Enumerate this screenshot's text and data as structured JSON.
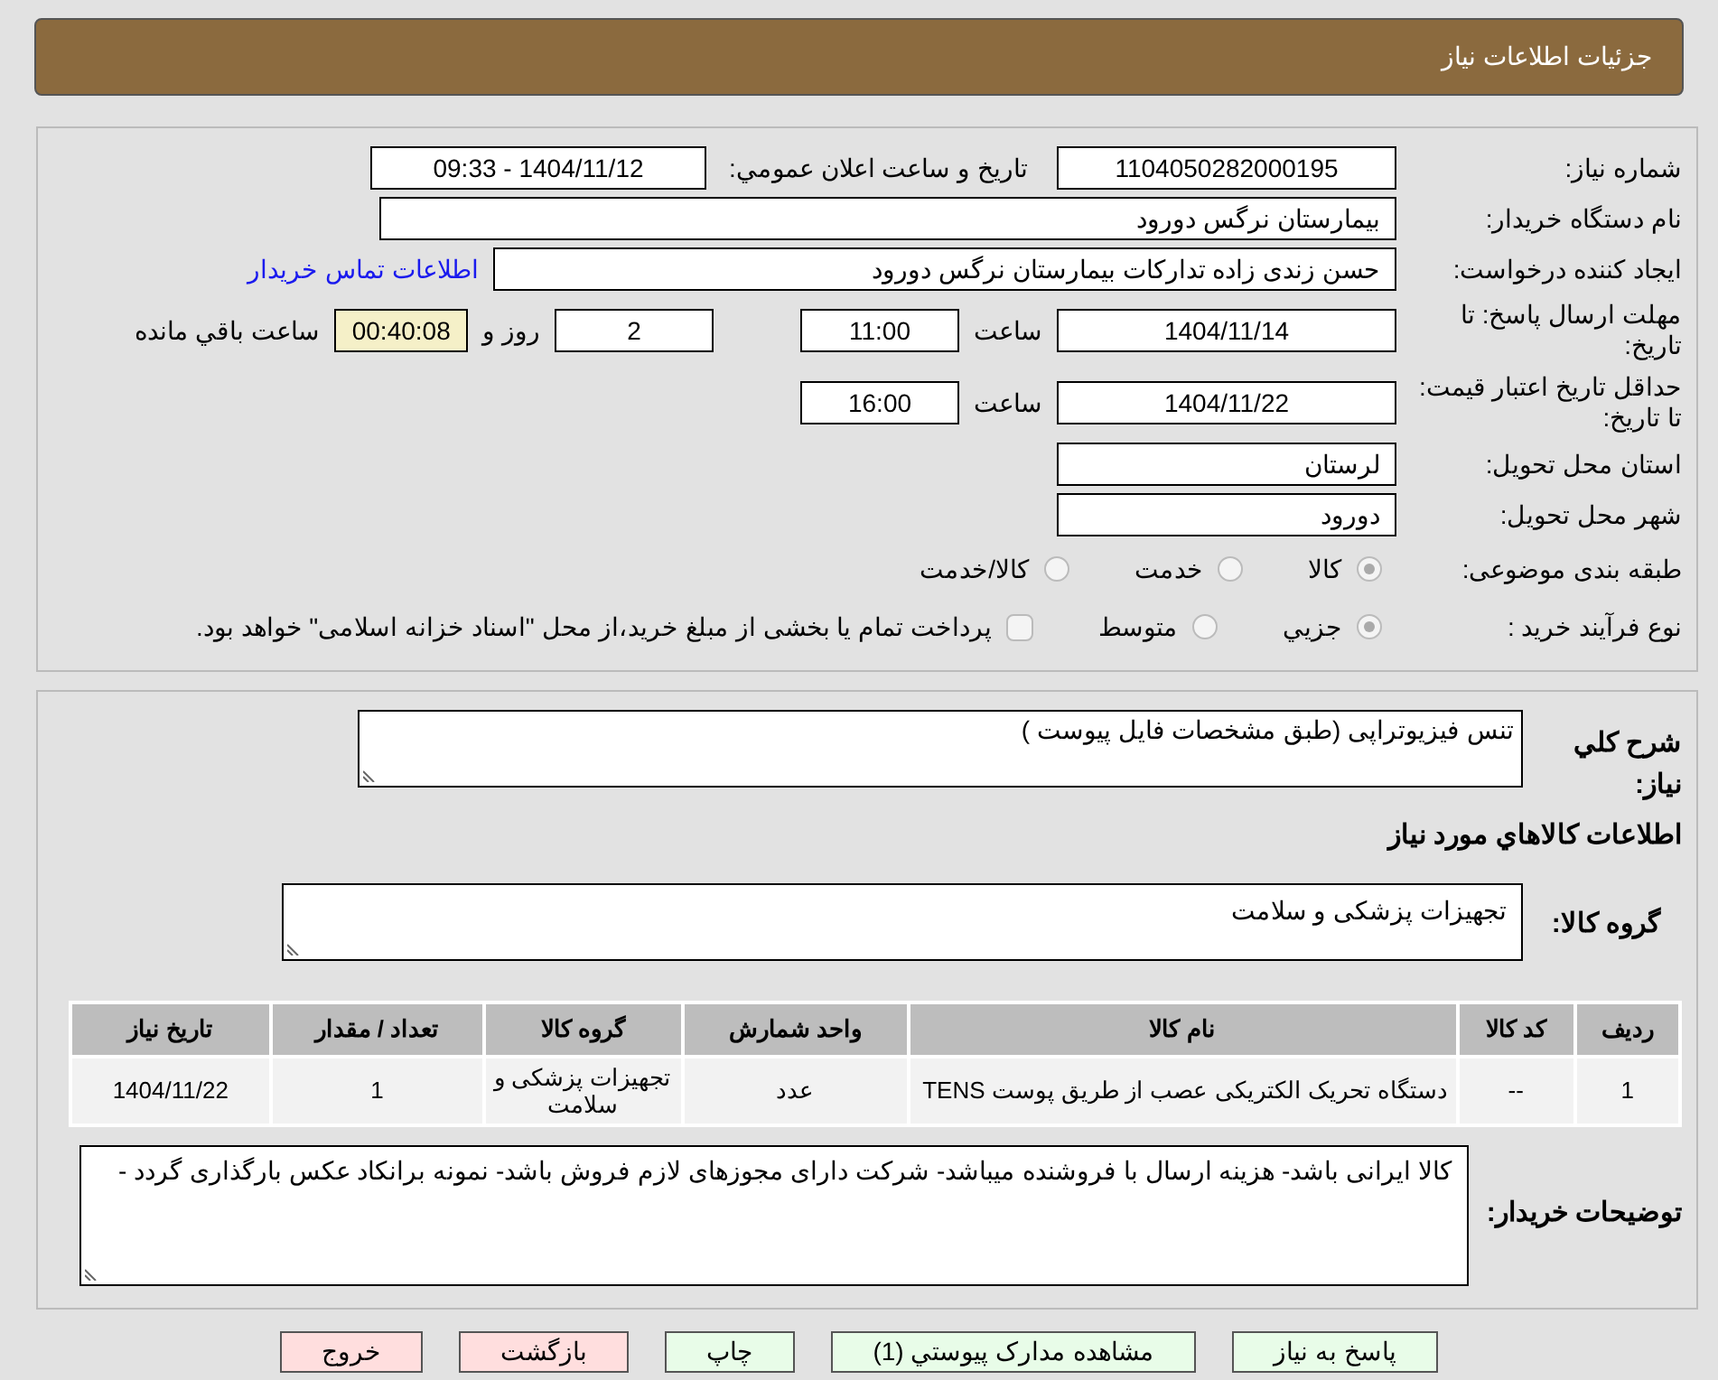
{
  "header": {
    "title": "جزئیات اطلاعات نیاز"
  },
  "need_number": {
    "label": "شماره نیاز:",
    "value": "1104050282000195"
  },
  "announce": {
    "label": "تاریخ و ساعت اعلان عمومي:",
    "value": "1404/11/12 - 09:33"
  },
  "buyer_org": {
    "label": "نام دستگاه خریدار:",
    "value": "بیمارستان نرگس دورود"
  },
  "requester": {
    "label": "ایجاد کننده درخواست:",
    "value": "حسن  زندی زاده  تدارکات بیمارستان نرگس دورود",
    "link": "اطلاعات تماس خریدار"
  },
  "deadline": {
    "label": "مهلت ارسال پاسخ: تا تاریخ:",
    "date": "1404/11/14",
    "time_label": "ساعت",
    "time": "11:00",
    "days": "2",
    "days_label": "روز و",
    "remaining": "00:40:08",
    "remaining_label": "ساعت باقي مانده"
  },
  "validity": {
    "label": "حداقل تاریخ اعتبار قیمت: تا تاریخ:",
    "date": "1404/11/22",
    "time_label": "ساعت",
    "time": "16:00"
  },
  "province": {
    "label": "استان محل تحویل:",
    "value": "لرستان"
  },
  "city": {
    "label": "شهر محل تحویل:",
    "value": "دورود"
  },
  "category": {
    "label": "طبقه بندی موضوعی:",
    "options": [
      {
        "label": "کالا",
        "selected": true
      },
      {
        "label": "خدمت",
        "selected": false
      },
      {
        "label": "کالا/خدمت",
        "selected": false
      }
    ]
  },
  "process": {
    "label": "نوع فرآیند خرید :",
    "options": [
      {
        "label": "جزيي",
        "selected": true
      },
      {
        "label": "متوسط",
        "selected": false
      }
    ],
    "checkbox": {
      "checked": false,
      "label": "پرداخت تمام یا بخشی از مبلغ خرید،از محل \"اسناد خزانه اسلامی\" خواهد بود."
    }
  },
  "description": {
    "label": "شرح کلي نیاز:",
    "value": "تنس فیزیوتراپی (طبق مشخصات فایل پیوست )"
  },
  "goods_title": "اطلاعات کالاهاي مورد نیاز",
  "goods_group": {
    "label": "گروه کالا:",
    "value": "تجهیزات پزشکی و سلامت"
  },
  "table": {
    "columns": [
      "ردیف",
      "کد کالا",
      "نام کالا",
      "واحد شمارش",
      "گروه کالا",
      "تعداد / مقدار",
      "تاریخ نیاز"
    ],
    "rows": [
      [
        "1",
        "--",
        "دستگاه تحریک الکتریکی عصب از طریق پوست TENS",
        "عدد",
        "تجهیزات پزشکی و سلامت",
        "1",
        "1404/11/22"
      ]
    ]
  },
  "buyer_notes": {
    "label": "توضیحات خریدار:",
    "value": "کالا ایرانی باشد- هزینه ارسال با فروشنده میباشد- شرکت دارای مجوزهای لازم فروش باشد- نمونه برانکاد عکس بارگذاری گردد -"
  },
  "buttons": [
    {
      "label": "پاسخ به نیاز",
      "kind": "primary"
    },
    {
      "label": "مشاهده مدارک پیوستي (1)",
      "kind": "primary"
    },
    {
      "label": "چاپ",
      "kind": "primary"
    },
    {
      "label": "بازگشت",
      "kind": "danger"
    },
    {
      "label": "خروج",
      "kind": "danger"
    }
  ]
}
